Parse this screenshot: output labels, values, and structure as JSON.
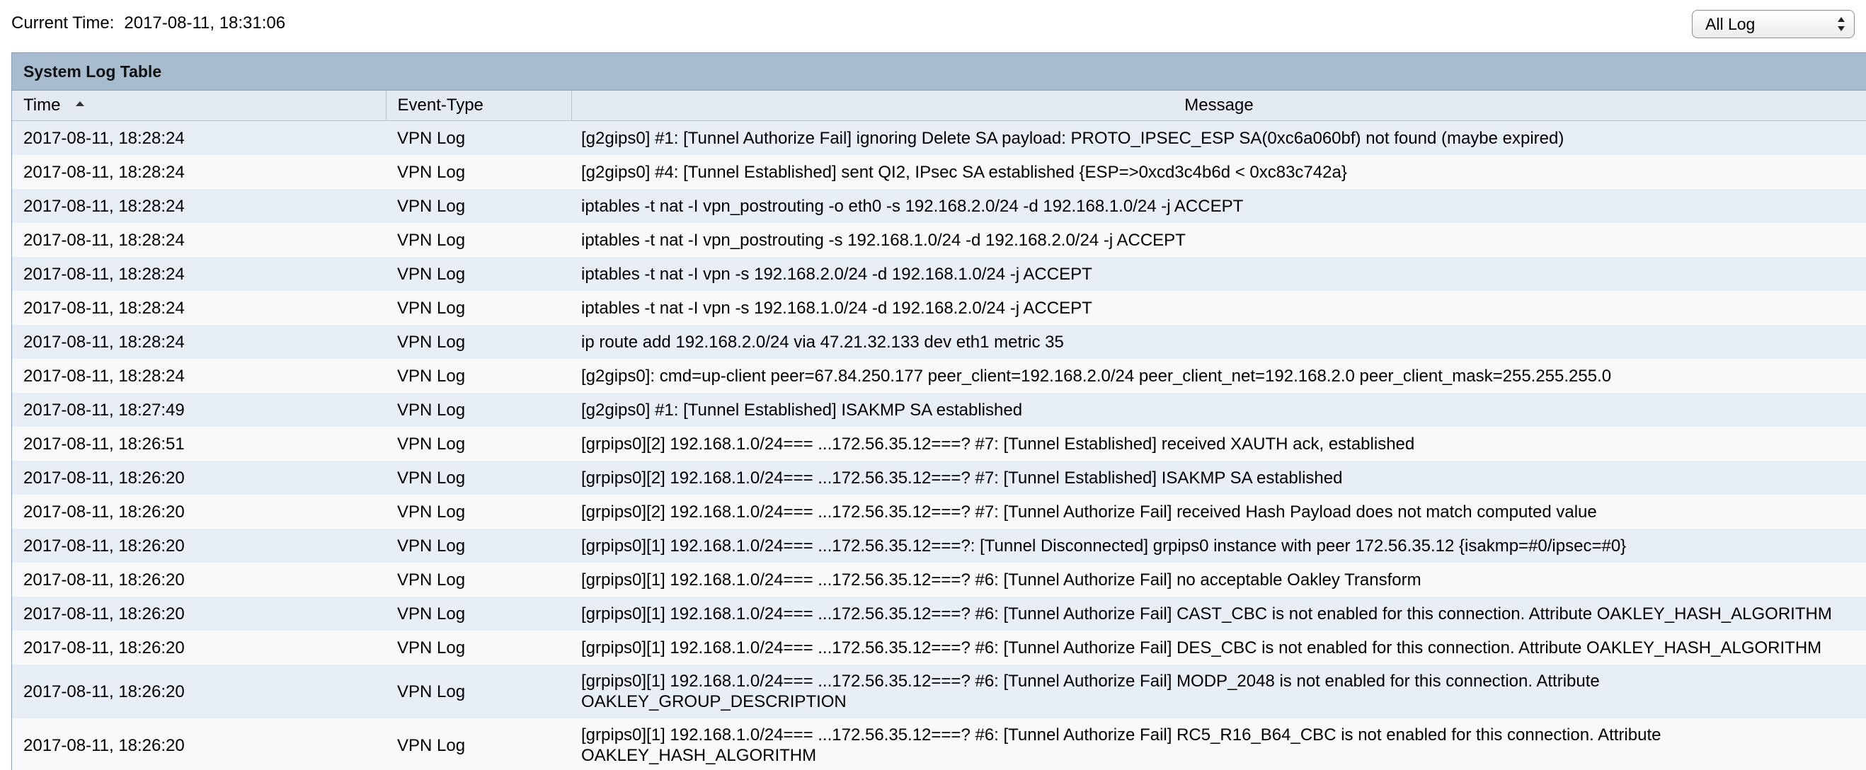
{
  "header": {
    "current_time_label": "Current Time:",
    "current_time_value": "2017-08-11, 18:31:06",
    "log_filter": {
      "selected": "All Log"
    }
  },
  "table": {
    "title": "System Log Table",
    "columns": {
      "time": "Time",
      "event_type": "Event-Type",
      "message": "Message"
    },
    "sort": {
      "column": "time",
      "direction": "ascending"
    },
    "rows": [
      {
        "time": "2017-08-11, 18:28:24",
        "type": "VPN Log",
        "message": "[g2gips0] #1: [Tunnel Authorize Fail] ignoring Delete SA payload: PROTO_IPSEC_ESP SA(0xc6a060bf) not found (maybe expired)"
      },
      {
        "time": "2017-08-11, 18:28:24",
        "type": "VPN Log",
        "message": "[g2gips0] #4: [Tunnel Established] sent QI2, IPsec SA established {ESP=>0xcd3c4b6d < 0xc83c742a}"
      },
      {
        "time": "2017-08-11, 18:28:24",
        "type": "VPN Log",
        "message": "iptables -t nat -I vpn_postrouting -o eth0 -s 192.168.2.0/24 -d 192.168.1.0/24 -j ACCEPT"
      },
      {
        "time": "2017-08-11, 18:28:24",
        "type": "VPN Log",
        "message": "iptables -t nat -I vpn_postrouting -s 192.168.1.0/24 -d 192.168.2.0/24 -j ACCEPT"
      },
      {
        "time": "2017-08-11, 18:28:24",
        "type": "VPN Log",
        "message": "iptables -t nat -I vpn -s 192.168.2.0/24 -d 192.168.1.0/24 -j ACCEPT"
      },
      {
        "time": "2017-08-11, 18:28:24",
        "type": "VPN Log",
        "message": "iptables -t nat -I vpn -s 192.168.1.0/24 -d 192.168.2.0/24 -j ACCEPT"
      },
      {
        "time": "2017-08-11, 18:28:24",
        "type": "VPN Log",
        "message": "ip route add 192.168.2.0/24 via 47.21.32.133 dev eth1 metric 35"
      },
      {
        "time": "2017-08-11, 18:28:24",
        "type": "VPN Log",
        "message": "[g2gips0]: cmd=up-client peer=67.84.250.177 peer_client=192.168.2.0/24 peer_client_net=192.168.2.0 peer_client_mask=255.255.255.0"
      },
      {
        "time": "2017-08-11, 18:27:49",
        "type": "VPN Log",
        "message": "[g2gips0] #1: [Tunnel Established] ISAKMP SA established"
      },
      {
        "time": "2017-08-11, 18:26:51",
        "type": "VPN Log",
        "message": "[grpips0][2] 192.168.1.0/24=== ...172.56.35.12===? #7: [Tunnel Established] received XAUTH ack, established"
      },
      {
        "time": "2017-08-11, 18:26:20",
        "type": "VPN Log",
        "message": "[grpips0][2] 192.168.1.0/24=== ...172.56.35.12===? #7: [Tunnel Established] ISAKMP SA established"
      },
      {
        "time": "2017-08-11, 18:26:20",
        "type": "VPN Log",
        "message": "[grpips0][2] 192.168.1.0/24=== ...172.56.35.12===? #7: [Tunnel Authorize Fail] received Hash Payload does not match computed value"
      },
      {
        "time": "2017-08-11, 18:26:20",
        "type": "VPN Log",
        "message": "[grpips0][1] 192.168.1.0/24=== ...172.56.35.12===?: [Tunnel Disconnected] grpips0 instance with peer 172.56.35.12 {isakmp=#0/ipsec=#0}"
      },
      {
        "time": "2017-08-11, 18:26:20",
        "type": "VPN Log",
        "message": "[grpips0][1] 192.168.1.0/24=== ...172.56.35.12===? #6: [Tunnel Authorize Fail] no acceptable Oakley Transform"
      },
      {
        "time": "2017-08-11, 18:26:20",
        "type": "VPN Log",
        "message": "[grpips0][1] 192.168.1.0/24=== ...172.56.35.12===? #6: [Tunnel Authorize Fail] CAST_CBC is not enabled for this connection. Attribute OAKLEY_HASH_ALGORITHM"
      },
      {
        "time": "2017-08-11, 18:26:20",
        "type": "VPN Log",
        "message": "[grpips0][1] 192.168.1.0/24=== ...172.56.35.12===? #6: [Tunnel Authorize Fail] DES_CBC is not enabled for this connection. Attribute OAKLEY_HASH_ALGORITHM"
      },
      {
        "time": "2017-08-11, 18:26:20",
        "type": "VPN Log",
        "message_line1": "[grpips0][1] 192.168.1.0/24=== ...172.56.35.12===? #6: [Tunnel Authorize Fail] MODP_2048 is not enabled for this connection. Attribute",
        "message_line2": "OAKLEY_GROUP_DESCRIPTION"
      },
      {
        "time": "2017-08-11, 18:26:20",
        "type": "VPN Log",
        "message_line1": "[grpips0][1] 192.168.1.0/24=== ...172.56.35.12===? #6: [Tunnel Authorize Fail] RC5_R16_B64_CBC is not enabled for this connection. Attribute",
        "message_line2": "OAKLEY_HASH_ALGORITHM"
      }
    ]
  }
}
